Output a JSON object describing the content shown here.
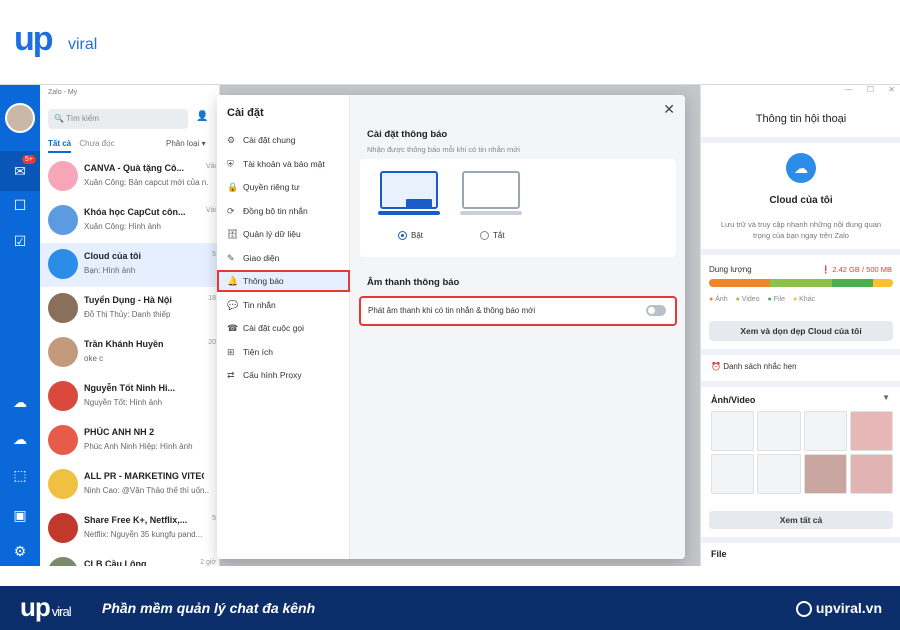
{
  "brand": {
    "logo": "up",
    "sub": "viral"
  },
  "window": {
    "title": "Zalo - My"
  },
  "rail": {
    "badge": "5+"
  },
  "list": {
    "search_placeholder": "Tìm kiếm",
    "tabs": [
      "Tất cả",
      "Chưa đọc"
    ],
    "filter": "Phân loại",
    "chats": [
      {
        "name": "CANVA - Quà tặng Cô...",
        "preview": "Xuân Công: Bản capcut mới của n...",
        "time": "Vài",
        "color": "#f6a6b8"
      },
      {
        "name": "Khóa học CapCut côn...",
        "preview": "Xuân Công: Hình ảnh",
        "time": "Vài",
        "color": "#5c9be0"
      },
      {
        "name": "Cloud của tôi",
        "preview": "Bạn: Hình ảnh",
        "time": "5",
        "color": "#2b8de8"
      },
      {
        "name": "Tuyển Dụng - Hà Nội",
        "preview": "Đỗ Thị Thủy: Danh thiếp",
        "time": "18",
        "color": "#8a6f5a"
      },
      {
        "name": "Trần Khánh Huyền",
        "preview": "oke c",
        "time": "20",
        "color": "#c49a7c"
      },
      {
        "name": "Nguyễn Tốt Ninh Hi...",
        "preview": "Nguyễn Tốt: Hình ảnh",
        "time": "",
        "color": "#d94a3d"
      },
      {
        "name": "PHÚC ANH NH 2",
        "preview": "Phúc Anh Ninh Hiệp: Hình ảnh",
        "time": "",
        "color": "#e85b4a"
      },
      {
        "name": "ALL PR - MARKETING VITECH",
        "preview": "Ninh Cao: @Văn Thảo thế thì uốn...",
        "time": "",
        "color": "#f0c040"
      },
      {
        "name": "Share Free K+, Netflix,...",
        "preview": "Netflix: Nguyễn 35 kungfu pand...",
        "time": "5",
        "color": "#c0392b"
      },
      {
        "name": "CLB Cầu Lông",
        "preview": "",
        "time": "2 giờ",
        "color": "#7a8a6a"
      }
    ]
  },
  "modal": {
    "title": "Cài đặt",
    "items": [
      {
        "label": "Cài đặt chung",
        "icon": "⚙"
      },
      {
        "label": "Tài khoản và bảo mật",
        "icon": "⛨"
      },
      {
        "label": "Quyền riêng tư",
        "icon": "🔒"
      },
      {
        "label": "Đồng bộ tin nhắn",
        "icon": "⟳"
      },
      {
        "label": "Quản lý dữ liệu",
        "icon": "🗄"
      },
      {
        "label": "Giao diện",
        "icon": "✎"
      },
      {
        "label": "Thông báo",
        "icon": "🔔"
      },
      {
        "label": "Tin nhắn",
        "icon": "💬"
      },
      {
        "label": "Cài đặt cuộc gọi",
        "icon": "☎"
      },
      {
        "label": "Tiện ích",
        "icon": "⊞"
      },
      {
        "label": "Cấu hình Proxy",
        "icon": "⇄"
      }
    ],
    "section1_title": "Cài đặt thông báo",
    "section1_sub": "Nhận được thông báo mỗi khi có tin nhắn mới",
    "radio_on": "Bật",
    "radio_off": "Tắt",
    "section2_title": "Âm thanh thông báo",
    "sound_label": "Phát âm thanh khi có tin nhắn & thông báo mới"
  },
  "right": {
    "title": "Thông tin hội thoại",
    "cloud_title": "Cloud của tôi",
    "cloud_desc": "Lưu trữ và truy cập nhanh những nội dung quan trọng của bạn ngay trên Zalo",
    "quota_label": "Dung lượng",
    "quota_value": "2.42 GB / 500 MB",
    "legend": [
      "Ảnh",
      "Video",
      "File",
      "Khác"
    ],
    "clean_btn": "Xem và dọn dẹp Cloud của tôi",
    "reminders": "Danh sách nhắc hẹn",
    "media_title": "Ảnh/Video",
    "see_all": "Xem tất cả",
    "file_title": "File"
  },
  "footer": {
    "logo": "up",
    "logo_sub": "viral",
    "slogan": "Phần mềm quản lý chat đa kênh",
    "website": "upviral.vn"
  }
}
